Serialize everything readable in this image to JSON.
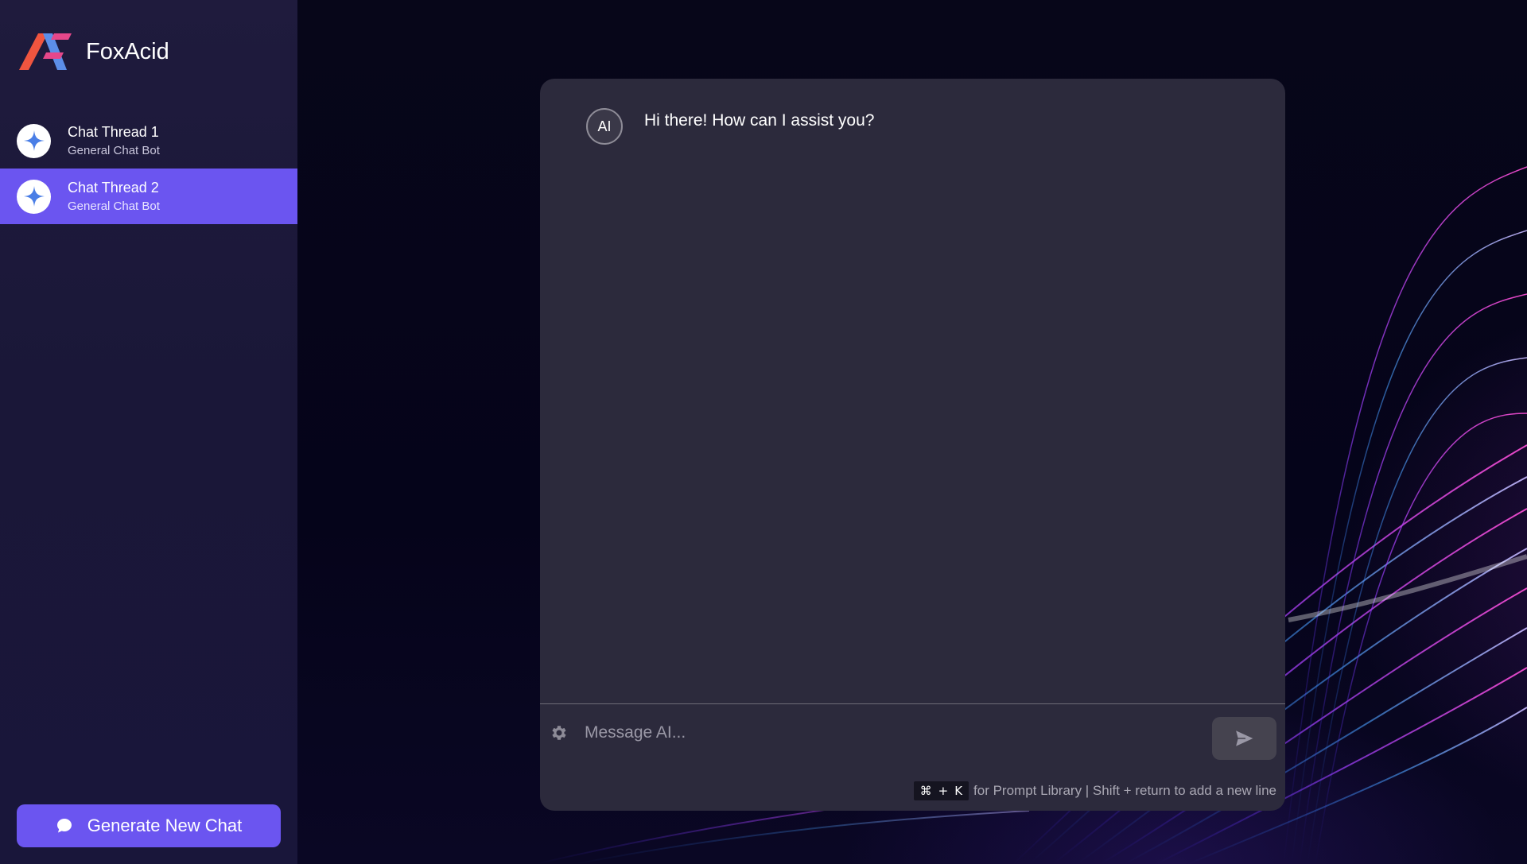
{
  "brand": {
    "name": "FoxAcid",
    "logo_colors": [
      "#f0553f",
      "#e6478a",
      "#5c8ee8"
    ]
  },
  "sidebar": {
    "threads": [
      {
        "title": "Chat Thread 1",
        "subtitle": "General Chat Bot",
        "icon": "sparkle-icon",
        "active": false
      },
      {
        "title": "Chat Thread 2",
        "subtitle": "General Chat Bot",
        "icon": "sparkle-icon",
        "active": true
      }
    ],
    "new_chat_label": "Generate New Chat",
    "new_chat_icon": "chat-bubble-icon"
  },
  "chat": {
    "messages": [
      {
        "sender": "AI",
        "avatar_label": "AI",
        "text": "Hi there! How can I assist you?"
      }
    ],
    "input_placeholder": "Message AI...",
    "settings_icon": "gear-icon",
    "send_icon": "send-icon",
    "hint": {
      "cmd_key": "⌘",
      "plus": "+",
      "k_key": "K",
      "text": "for Prompt Library | Shift + return to add a new line"
    }
  },
  "colors": {
    "accent": "#6b55f0",
    "sidebar_bg": "#1d1a3c",
    "panel_bg": "#2c2a3c",
    "page_bg": "#06051a"
  }
}
